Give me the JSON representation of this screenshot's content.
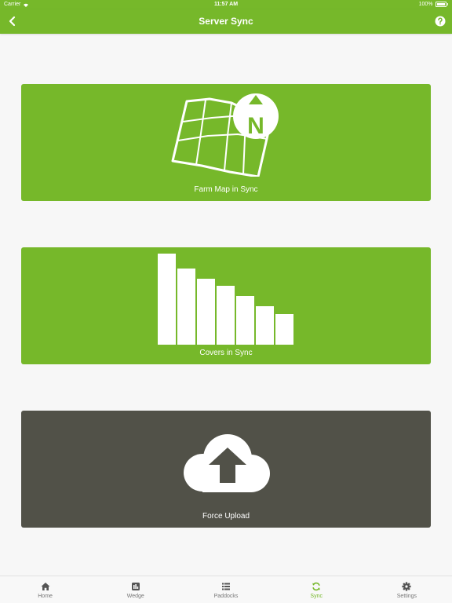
{
  "status_bar": {
    "carrier": "Carrier",
    "time": "11:57 AM",
    "battery": "100%"
  },
  "nav": {
    "title": "Server Sync",
    "back_icon": "chevron-left-icon",
    "help_icon": "question-circle-icon"
  },
  "cards": [
    {
      "label": "Farm Map in Sync",
      "icon": "farm-map-north-icon",
      "color": "#76b82a"
    },
    {
      "label": "Covers in Sync",
      "icon": "covers-bar-chart-icon",
      "color": "#76b82a"
    },
    {
      "label": "Force Upload",
      "icon": "cloud-upload-icon",
      "color": "#515148"
    }
  ],
  "tabs": [
    {
      "label": "Home",
      "icon": "home-icon",
      "active": false
    },
    {
      "label": "Wedge",
      "icon": "bar-chart-icon",
      "active": false
    },
    {
      "label": "Paddocks",
      "icon": "list-icon",
      "active": false
    },
    {
      "label": "Sync",
      "icon": "sync-icon",
      "active": true
    },
    {
      "label": "Settings",
      "icon": "gear-icon",
      "active": false
    }
  ],
  "colors": {
    "accent": "#76b82a",
    "upload_card": "#515148",
    "background": "#f7f7f7",
    "tab_inactive": "#777777"
  }
}
